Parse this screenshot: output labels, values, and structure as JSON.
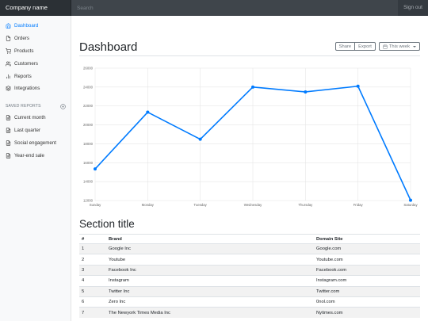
{
  "navbar": {
    "brand": "Company name",
    "search_placeholder": "Search",
    "signout_label": "Sign out"
  },
  "sidebar": {
    "items": [
      {
        "label": "Dashboard",
        "icon": "home-icon",
        "active": true
      },
      {
        "label": "Orders",
        "icon": "file-icon",
        "active": false
      },
      {
        "label": "Products",
        "icon": "shopping-cart-icon",
        "active": false
      },
      {
        "label": "Customers",
        "icon": "users-icon",
        "active": false
      },
      {
        "label": "Reports",
        "icon": "bar-chart-icon",
        "active": false
      },
      {
        "label": "Integrations",
        "icon": "layers-icon",
        "active": false
      }
    ],
    "saved_reports_heading": "SAVED REPORTS",
    "saved_reports": [
      {
        "label": "Current month",
        "icon": "file-text-icon"
      },
      {
        "label": "Last quarter",
        "icon": "file-text-icon"
      },
      {
        "label": "Social engagement",
        "icon": "file-text-icon"
      },
      {
        "label": "Year-end sale",
        "icon": "file-text-icon"
      }
    ]
  },
  "main": {
    "title": "Dashboard",
    "share_label": "Share",
    "export_label": "Export",
    "period_label": "This week",
    "section_title": "Section title"
  },
  "colors": {
    "accent": "#007bff",
    "line": "#007bff",
    "navbar": "#343a40"
  },
  "chart_data": {
    "type": "line",
    "categories": [
      "Sunday",
      "Monday",
      "Tuesday",
      "Wednesday",
      "Thursday",
      "Friday",
      "Saturday"
    ],
    "values": [
      15339,
      21345,
      18483,
      24003,
      23489,
      24092,
      12034
    ],
    "ylim": [
      12000,
      26000
    ],
    "yticks": [
      12000,
      14000,
      16000,
      18000,
      20000,
      22000,
      24000,
      26000
    ],
    "grid": true,
    "legend": "none"
  },
  "table": {
    "columns": [
      "#",
      "Brand",
      "Domain Site"
    ],
    "rows": [
      [
        "1",
        "Google Inc",
        "Google.com"
      ],
      [
        "2",
        "Youtube",
        "Youtube.com"
      ],
      [
        "3",
        "Facebook Inc",
        "Facebook.com"
      ],
      [
        "4",
        "Instagram",
        "Instagram.com"
      ],
      [
        "5",
        "Twitter Inc",
        "Twitter.com"
      ],
      [
        "6",
        "Zero Inc",
        "0nol.com"
      ],
      [
        "7",
        "The Newyork Times Media Inc",
        "Nytimes.com"
      ]
    ]
  }
}
